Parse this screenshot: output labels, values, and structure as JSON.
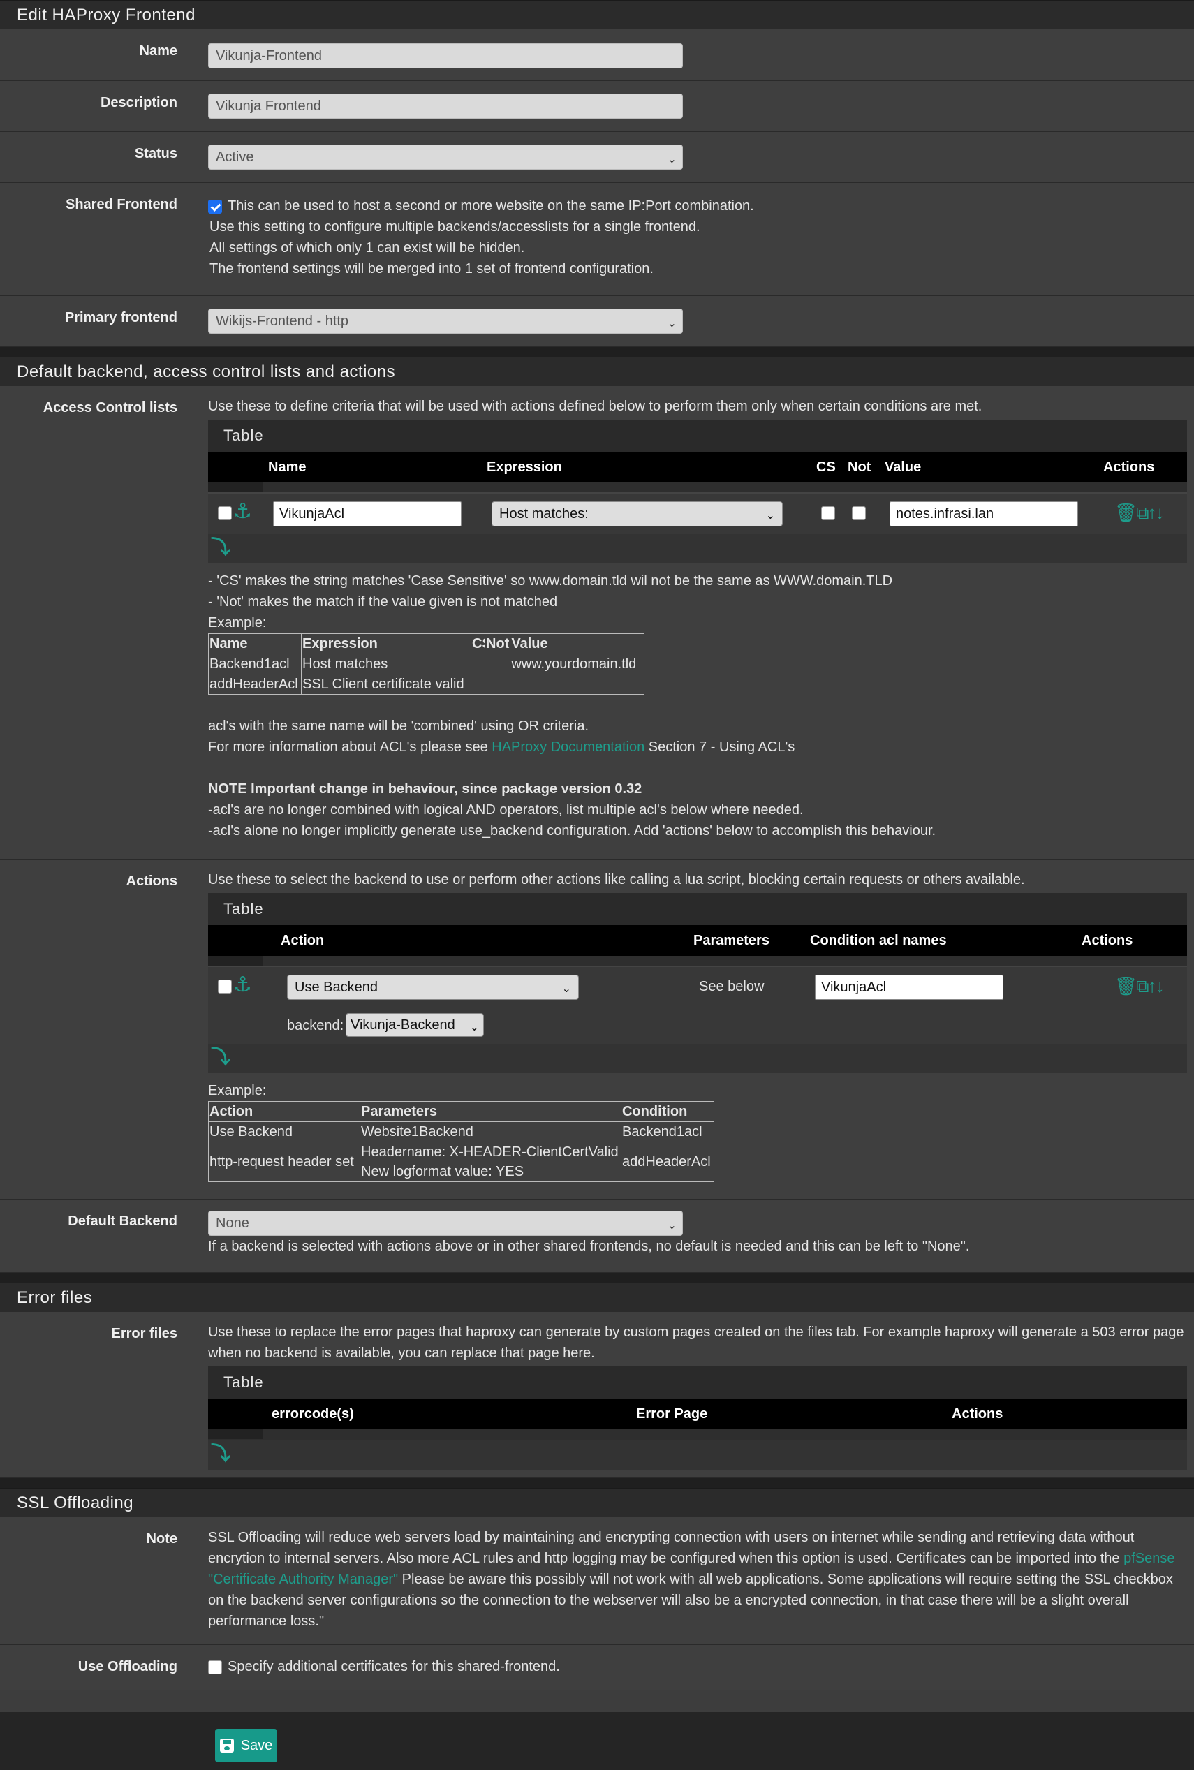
{
  "page_title": "Edit HAProxy Frontend",
  "general": {
    "name": {
      "label": "Name",
      "value": "Vikunja-Frontend"
    },
    "description": {
      "label": "Description",
      "value": "Vikunja Frontend"
    },
    "status": {
      "label": "Status",
      "value": "Active"
    },
    "shared_frontend": {
      "label": "Shared Frontend",
      "checked": true,
      "checkbox_text": "This can be used to host a second or more website on the same IP:Port combination.",
      "help": [
        "Use this setting to configure multiple backends/accesslists for a single frontend.",
        "All settings of which only 1 can exist will be hidden.",
        "The frontend settings will be merged into 1 set of frontend configuration."
      ]
    },
    "primary_frontend": {
      "label": "Primary frontend",
      "value": "Wikijs-Frontend - http"
    }
  },
  "acl_section": {
    "title": "Default backend, access control lists and actions",
    "acl": {
      "label": "Access Control lists",
      "intro": "Use these to define criteria that will be used with actions defined below to perform them only when certain conditions are met.",
      "table_title": "Table",
      "columns": {
        "name": "Name",
        "expression": "Expression",
        "cs": "CS",
        "not": "Not",
        "value": "Value",
        "actions": "Actions"
      },
      "row": {
        "name": "VikunjaAcl",
        "expression": "Host matches:",
        "value": "notes.infrasi.lan"
      },
      "notes": [
        "- 'CS' makes the string matches 'Case Sensitive' so www.domain.tld wil not be the same as WWW.domain.TLD",
        "- 'Not' makes the match if the value given is not matched",
        "Example:"
      ],
      "example": {
        "headers": [
          "Name",
          "Expression",
          "CS",
          "Not",
          "Value"
        ],
        "rows": [
          [
            "Backend1acl",
            "Host matches",
            "",
            "",
            "www.yourdomain.tld"
          ],
          [
            "addHeaderAcl",
            "SSL Client certificate valid",
            "",
            "",
            ""
          ]
        ]
      },
      "combined_text": "acl's with the same name will be 'combined' using OR criteria.",
      "more_info_prefix": "For more information about ACL's please see ",
      "more_info_link": "HAProxy Documentation",
      "more_info_suffix": " Section 7 - Using ACL's",
      "important_title": "NOTE Important change in behaviour, since package version 0.32",
      "important_lines": [
        "-acl's are no longer combined with logical AND operators, list multiple acl's below where needed.",
        "-acl's alone no longer implicitly generate use_backend configuration. Add 'actions' below to accomplish this behaviour."
      ]
    },
    "actions": {
      "label": "Actions",
      "intro": "Use these to select the backend to use or perform other actions like calling a lua script, blocking certain requests or others available.",
      "table_title": "Table",
      "columns": {
        "action": "Action",
        "parameters": "Parameters",
        "condition": "Condition acl names",
        "actions": "Actions"
      },
      "row": {
        "action": "Use Backend",
        "parameters": "See below",
        "condition": "VikunjaAcl",
        "backend_label": "backend:",
        "backend_value": "Vikunja-Backend"
      },
      "example_label": "Example:",
      "example": {
        "headers": [
          "Action",
          "Parameters",
          "Condition"
        ],
        "row1": [
          "Use Backend",
          "Website1Backend",
          "Backend1acl"
        ],
        "row2_action": "http-request header set",
        "row2_params": [
          "Headername: X-HEADER-ClientCertValid",
          "New logformat value: YES"
        ],
        "row2_condition": "addHeaderAcl"
      }
    },
    "default_backend": {
      "label": "Default Backend",
      "value": "None",
      "help": "If a backend is selected with actions above or in other shared frontends, no default is needed and this can be left to \"None\"."
    }
  },
  "error_section": {
    "title": "Error files",
    "label": "Error files",
    "intro": "Use these to replace the error pages that haproxy can generate by custom pages created on the files tab. For example haproxy will generate a 503 error page when no backend is available, you can replace that page here.",
    "table_title": "Table",
    "columns": {
      "errorcode": "errorcode(s)",
      "page": "Error Page",
      "actions": "Actions"
    }
  },
  "ssl_section": {
    "title": "SSL Offloading",
    "note_label": "Note",
    "note_part1": "SSL Offloading will reduce web servers load by maintaining and encrypting connection with users on internet while sending and retrieving data without encrytion to internal servers. Also more ACL rules and http logging may be configured when this option is used. Certificates can be imported into the ",
    "note_link": "pfSense \"Certificate Authority Manager\"",
    "note_part2": " Please be aware this possibly will not work with all web applications. Some applications will require setting the SSL checkbox on the backend server configurations so the connection to the webserver will also be a encrypted connection, in that case there will be a slight overall performance loss.\"",
    "offload_label": "Use Offloading",
    "offload_checked": false,
    "offload_text": "Specify additional certificates for this shared-frontend."
  },
  "save_label": "Save",
  "colors": {
    "accent": "#1e9d8c",
    "checkbox_on": "#1c6ff2",
    "background": "#3d3d3d"
  }
}
